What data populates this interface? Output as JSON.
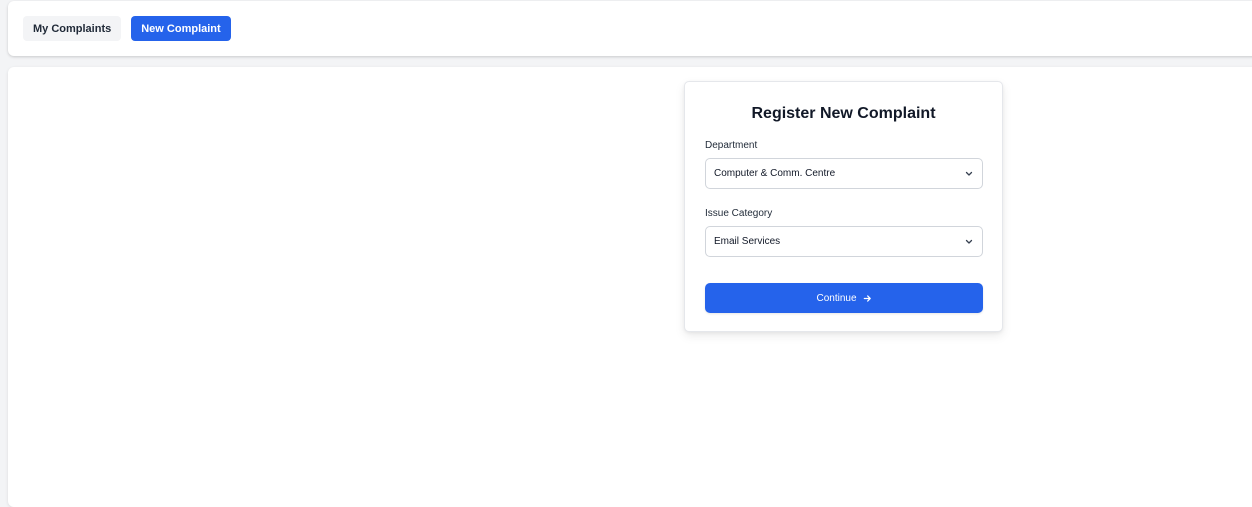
{
  "nav": {
    "tabs": [
      {
        "label": "My Complaints",
        "active": false
      },
      {
        "label": "New Complaint",
        "active": true
      }
    ]
  },
  "form": {
    "title": "Register New Complaint",
    "department": {
      "label": "Department",
      "value": "Computer & Comm. Centre"
    },
    "issue_category": {
      "label": "Issue Category",
      "value": "Email Services"
    },
    "continue_label": "Continue"
  },
  "icons": {
    "dropdown": "chevron-down-icon",
    "continue": "arrow-right-icon"
  },
  "colors": {
    "accent": "#2563eb",
    "background": "#f3f4f6",
    "surface": "#ffffff"
  }
}
